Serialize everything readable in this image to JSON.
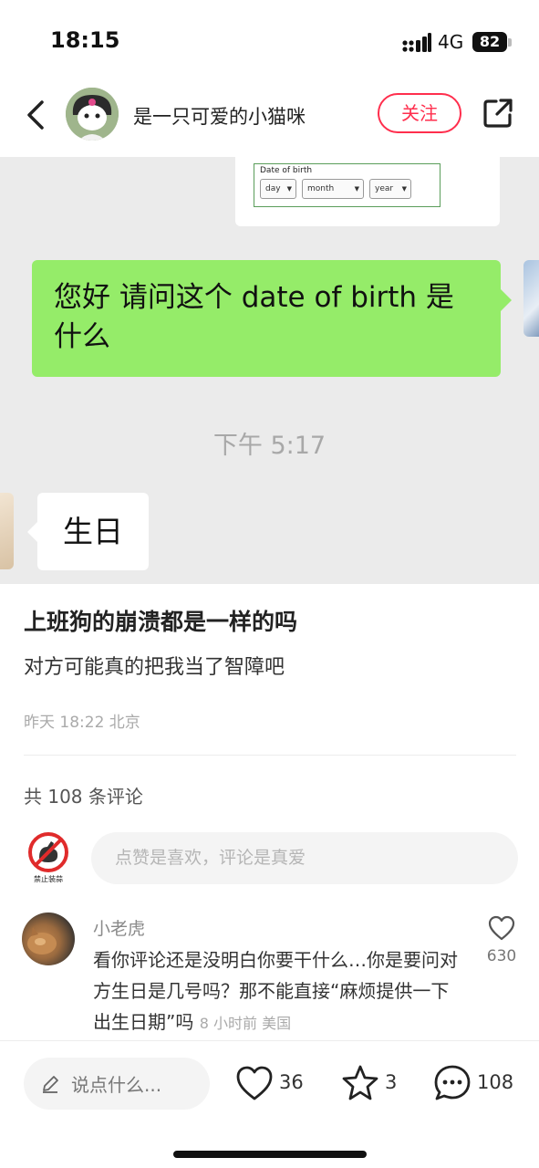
{
  "status_bar": {
    "time": "18:15",
    "network": "4G",
    "battery": "82"
  },
  "nav": {
    "title": "是一只可爱的小猫咪",
    "follow_label": "关注"
  },
  "image": {
    "form": {
      "label": "Date of birth",
      "selects": [
        "day",
        "month",
        "year"
      ]
    },
    "question_bubble": "您好 请问这个 date of birth 是什么",
    "chat_time": "下午 5:17",
    "answer_bubble": "生日"
  },
  "post": {
    "title": "上班狗的崩溃都是一样的吗",
    "body": "对方可能真的把我当了智障吧",
    "meta": "昨天 18:22 北京"
  },
  "comments": {
    "count_label": "共 108 条评论",
    "input_placeholder": "点赞是喜欢，评论是真爱",
    "my_badge": "禁止装蒜",
    "items": [
      {
        "user": "小老虎",
        "text": "看你评论还是没明白你要干什么…你是要问对方生日是几号吗？那不能直接“麻烦提供一下出生日期”吗",
        "time": "8 小时前 美国",
        "likes": "630"
      }
    ]
  },
  "bottom_bar": {
    "say_placeholder": "说点什么...",
    "likes": "36",
    "stars": "3",
    "comments": "108"
  },
  "colors": {
    "accent": "#ff2e4d",
    "bubble_green": "#95ec69",
    "image_bg": "#ebebeb"
  }
}
